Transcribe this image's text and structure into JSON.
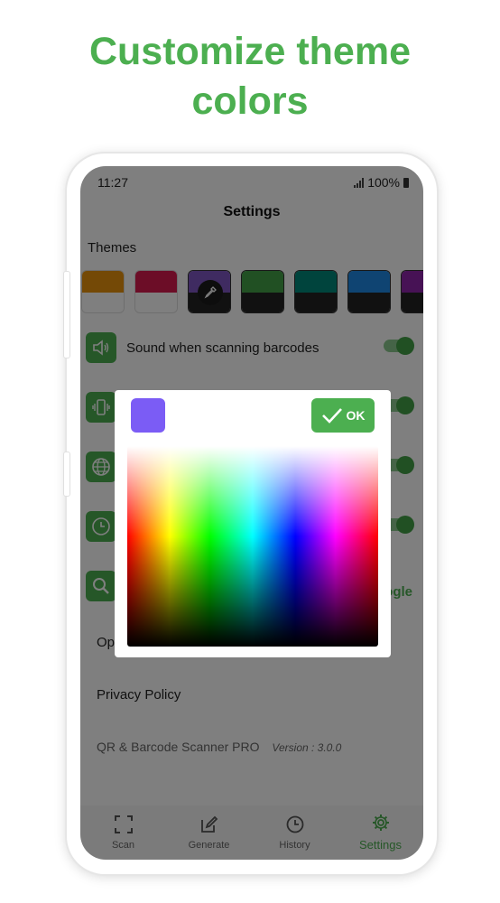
{
  "headline": {
    "line1": "Customize theme",
    "line2": "colors"
  },
  "status": {
    "time": "11:27",
    "battery": "100%"
  },
  "header": {
    "title": "Settings"
  },
  "themes": {
    "label": "Themes",
    "swatches": [
      {
        "top": "#e8930c",
        "bottom": "#ffffff"
      },
      {
        "top": "#d81b4f",
        "bottom": "#ffffff"
      },
      {
        "top": "#7e57c2",
        "bottom": "#222222"
      },
      {
        "top": "#43a047",
        "bottom": "#222222"
      },
      {
        "top": "#00897b",
        "bottom": "#222222"
      },
      {
        "top": "#1e88e5",
        "bottom": "#222222"
      },
      {
        "top": "#8e24aa",
        "bottom": "#222222"
      }
    ]
  },
  "settings": {
    "sound_label": "Sound when scanning barcodes",
    "google_label": "ogle",
    "open_label": "Op",
    "privacy_label": "Privacy Policy",
    "app_name": "QR & Barcode Scanner PRO",
    "version": "Version : 3.0.0"
  },
  "nav": {
    "scan": "Scan",
    "generate": "Generate",
    "history": "History",
    "settings": "Settings"
  },
  "dialog": {
    "ok_label": "OK",
    "selected_color": "#7b5cf5"
  },
  "colors": {
    "accent": "#4caf50"
  }
}
